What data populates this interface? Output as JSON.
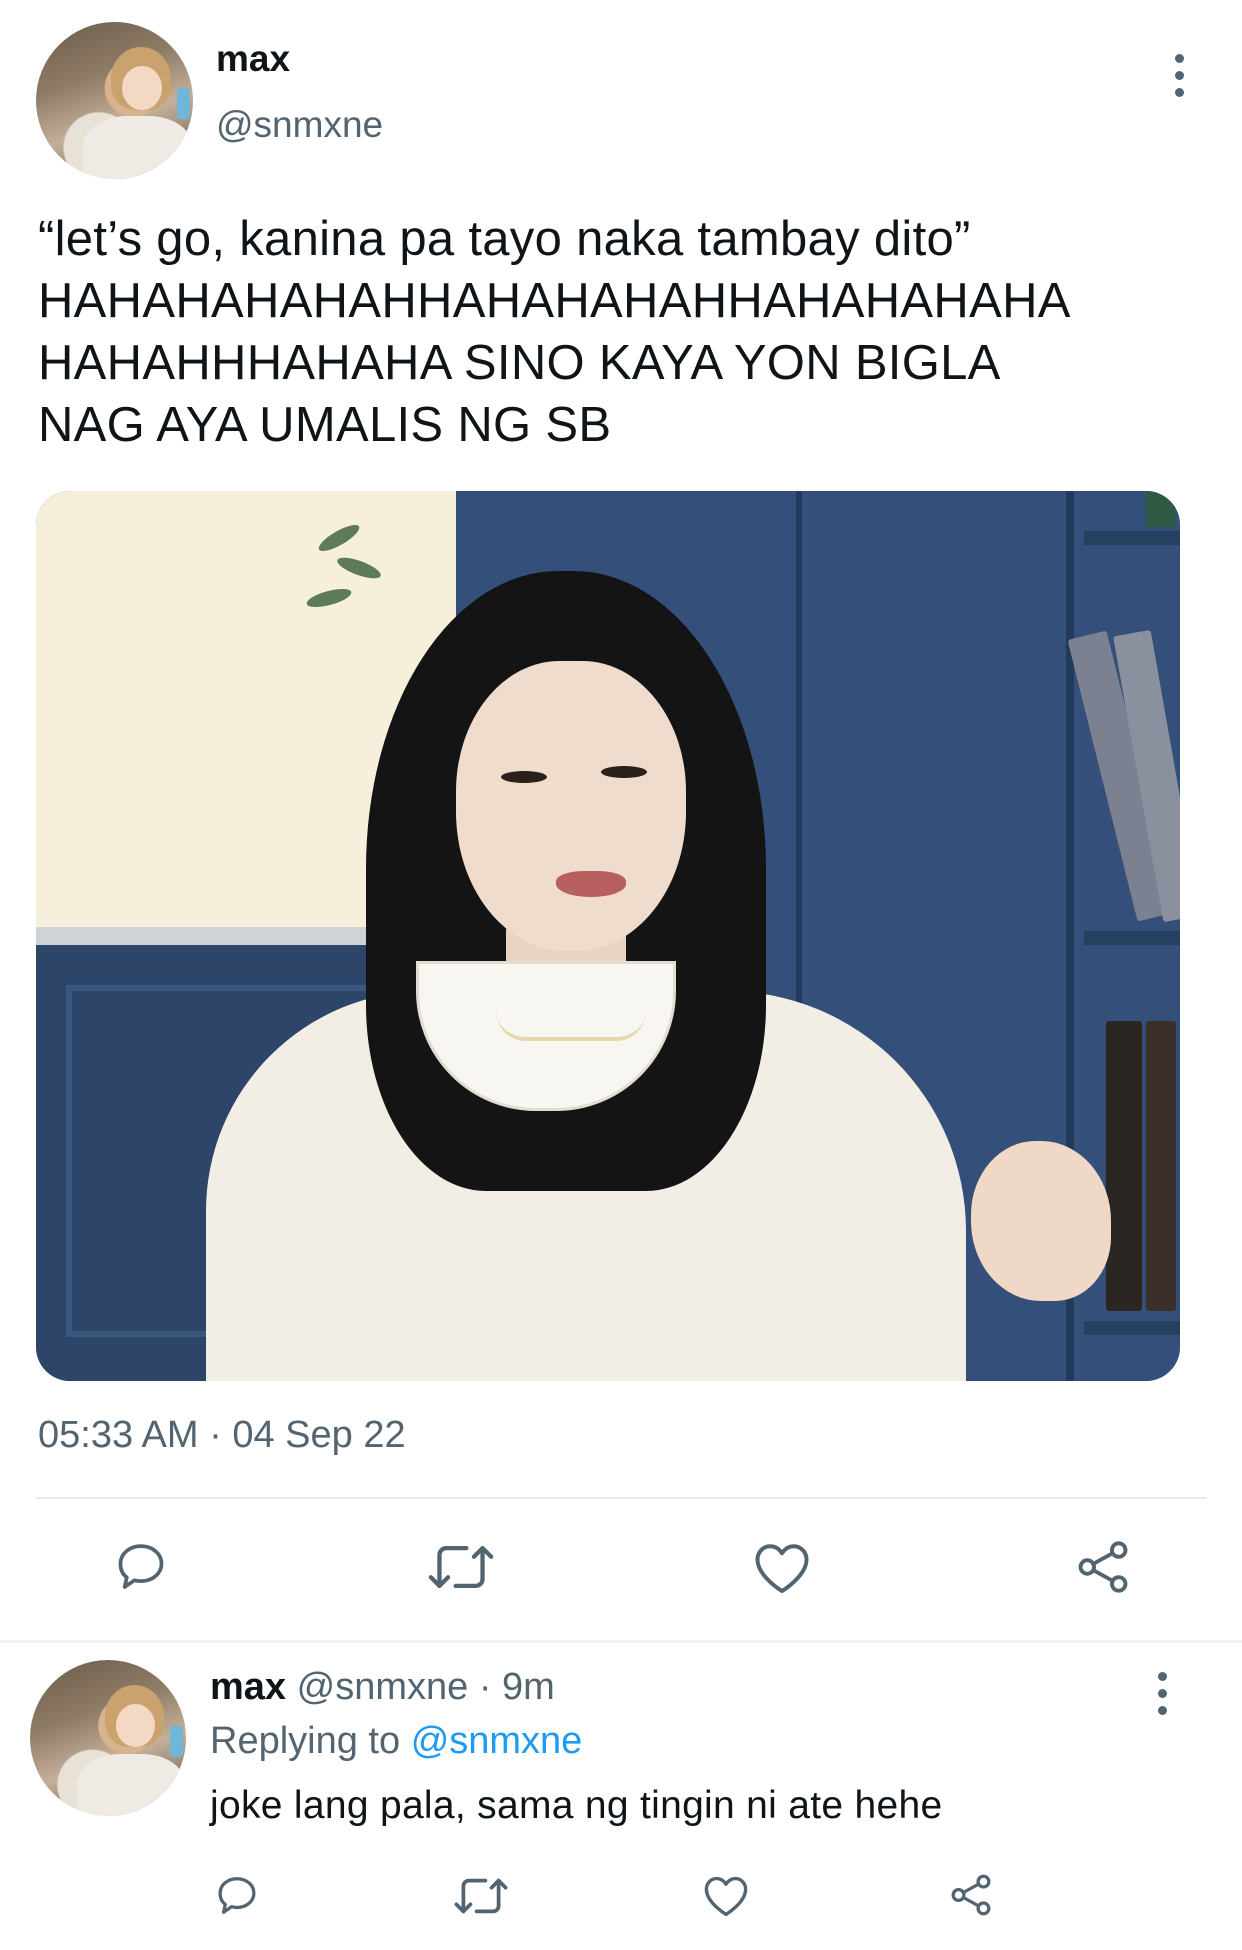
{
  "main_tweet": {
    "display_name": "max",
    "handle": "@snmxne",
    "text": "“let’s go, kanina pa tayo naka tambay dito”\nHAHAHAHAHAHHAHAHAHAHHAHAHAHAHA\nHAHAHHHAHAHA SINO KAYA YON BIGLA\nNAG AYA UMALIS NG SB",
    "timestamp": "05:33 AM · 04 Sep 22",
    "actions": [
      "reply-icon",
      "retweet-icon",
      "like-icon",
      "share-icon"
    ]
  },
  "reply_tweet": {
    "display_name": "max",
    "handle": "@snmxne",
    "separator": "·",
    "age": "9m",
    "replying_prefix": "Replying to",
    "replying_mention": "@snmxne",
    "text": "joke lang pala, sama ng tingin ni ate hehe",
    "actions": [
      "reply-icon",
      "retweet-icon",
      "like-icon",
      "share-icon"
    ]
  },
  "colors": {
    "text_primary": "#0f1419",
    "text_secondary": "#536471",
    "accent": "#1d9bf0",
    "divider": "#e7eaed"
  }
}
